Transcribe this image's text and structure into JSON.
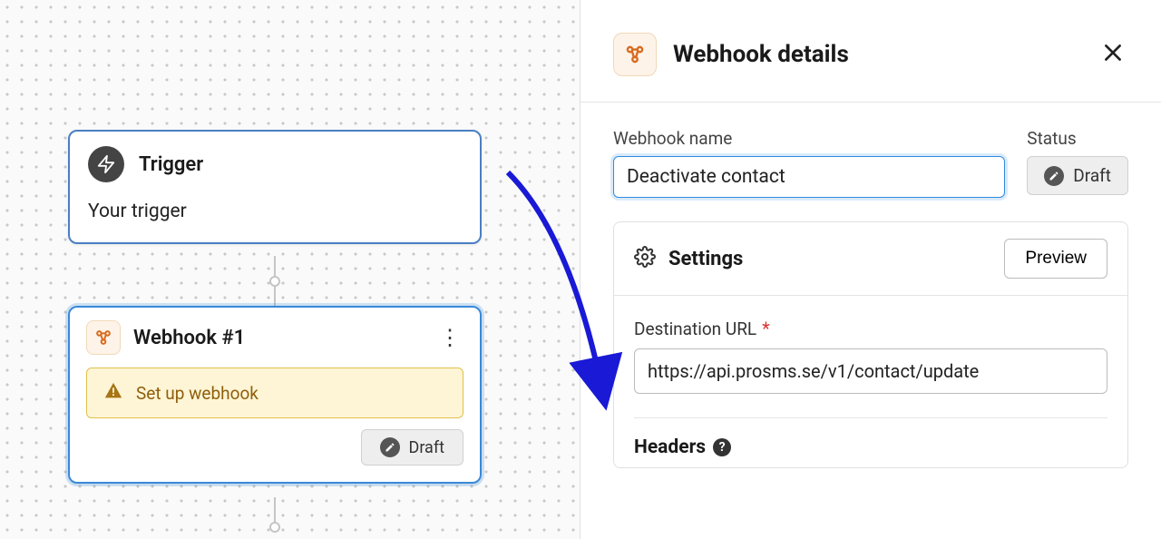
{
  "canvas": {
    "trigger": {
      "title": "Trigger",
      "body": "Your trigger"
    },
    "webhook": {
      "title": "Webhook #1",
      "warning": "Set up webhook",
      "status": "Draft"
    }
  },
  "panel": {
    "title": "Webhook details",
    "name_label": "Webhook name",
    "name_value": "Deactivate contact",
    "status_label": "Status",
    "status_value": "Draft",
    "settings": {
      "title": "Settings",
      "preview_label": "Preview",
      "dest_label": "Destination URL",
      "dest_value": "https://api.prosms.se/v1/contact/update",
      "headers_label": "Headers"
    }
  },
  "icons": {
    "lightning": "lightning-icon",
    "webhook": "webhook-icon",
    "more": "more-vertical-icon",
    "warning": "warning-triangle-icon",
    "pencil": "pencil-icon",
    "close": "close-icon",
    "gear": "gear-icon",
    "help": "help-icon"
  }
}
